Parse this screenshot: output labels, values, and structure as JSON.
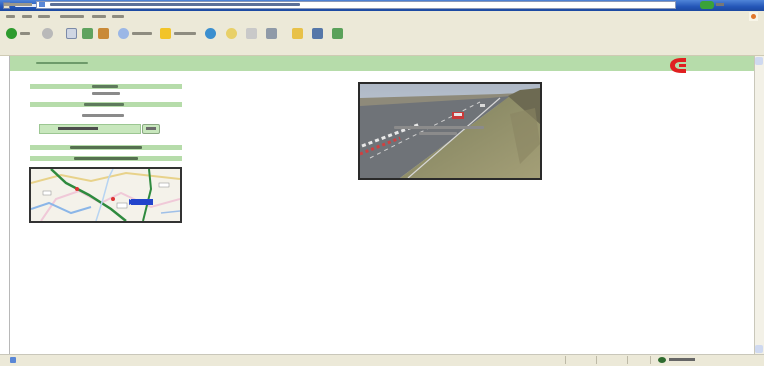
{
  "window": {
    "title": "",
    "menu": [
      "",
      "",
      "",
      "",
      "",
      ""
    ]
  },
  "address": {
    "label": "",
    "url": ""
  },
  "site": {
    "title": ""
  },
  "sidebar": {
    "heading_1": "",
    "text_1": "",
    "heading_2": "",
    "text_2": "",
    "select_value": "",
    "go_label": "",
    "link_1": "",
    "link_2": ""
  },
  "camera": {
    "caption_line_1": "",
    "caption_line_2": ""
  },
  "status": {
    "text": "",
    "zone": ""
  },
  "colors": {
    "header_green": "#b6dcaa",
    "select_green": "#c8e7bd",
    "logo_red": "#e02020",
    "titlebar_blue": "#2456b8"
  }
}
